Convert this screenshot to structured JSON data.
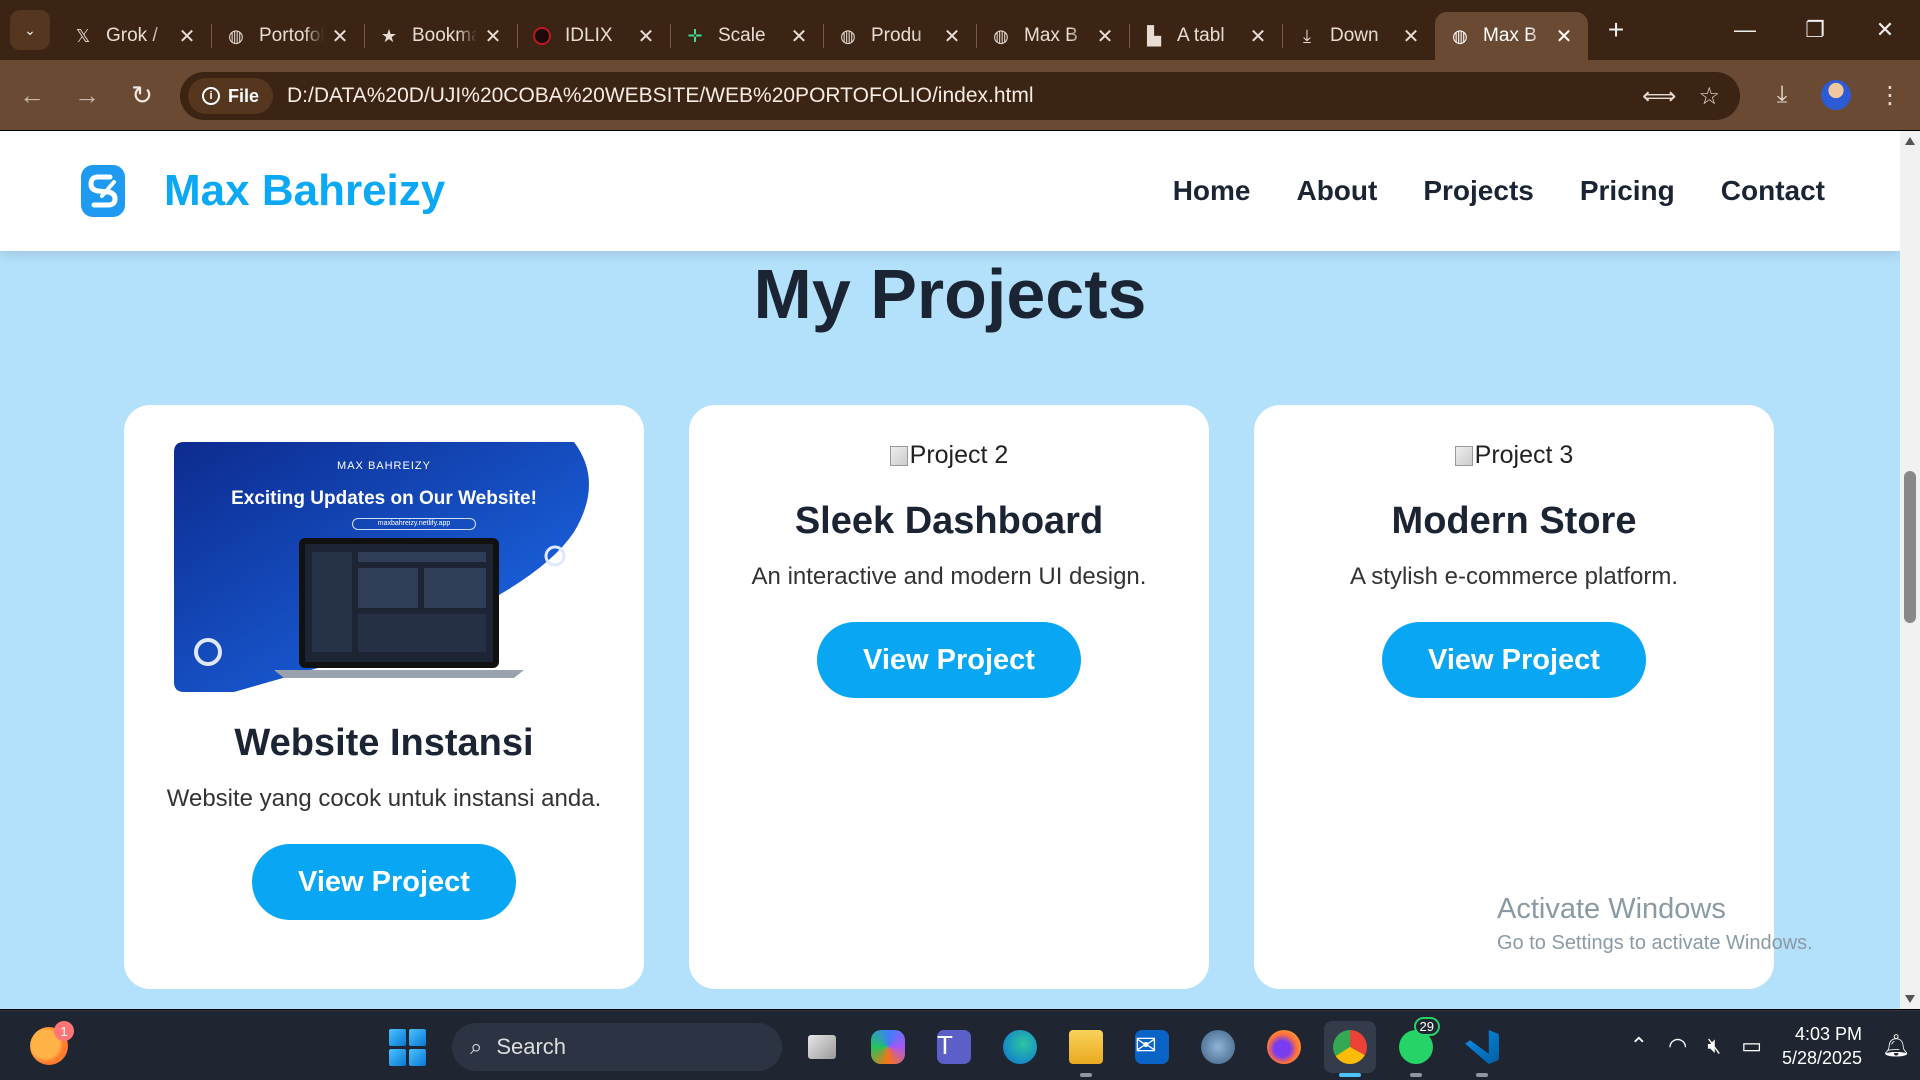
{
  "browser": {
    "tabs": [
      {
        "title": "Grok / ",
        "icon": "x-logo-icon"
      },
      {
        "title": "Portofolio",
        "icon": "globe-icon"
      },
      {
        "title": "Bookmarks",
        "icon": "star-icon"
      },
      {
        "title": "IDLIX",
        "icon": "idlix-icon"
      },
      {
        "title": "Scale",
        "icon": "scale-icon"
      },
      {
        "title": "Produ",
        "icon": "globe-icon"
      },
      {
        "title": "Max B",
        "icon": "globe-icon"
      },
      {
        "title": "A tabl",
        "icon": "table-icon"
      },
      {
        "title": "Down",
        "icon": "download-icon"
      },
      {
        "title": "Max B",
        "icon": "globe-icon",
        "active": true
      }
    ],
    "site_chip": "File",
    "url": "D:/DATA%20D/UJI%20COBA%20WEBSITE/WEB%20PORTOFOLIO/index.html"
  },
  "site": {
    "brand": "Max Bahreizy",
    "nav": [
      "Home",
      "About",
      "Projects",
      "Pricing",
      "Contact"
    ],
    "section_title": "My Projects",
    "projects": [
      {
        "title": "Website Instansi",
        "description": "Website yang cocok untuk instansi anda.",
        "button": "View Project",
        "thumbnail": {
          "brand": "MAX BAHREIZY",
          "headline": "Exciting Updates on Our Website!",
          "url_pill": "maxbahreizy.netlify.app"
        }
      },
      {
        "image_alt": "Project 2",
        "title": "Sleek Dashboard",
        "description": "An interactive and modern UI design.",
        "button": "View Project"
      },
      {
        "image_alt": "Project 3",
        "title": "Modern Store",
        "description": "A stylish e-commerce platform.",
        "button": "View Project"
      }
    ]
  },
  "watermark": {
    "line1": "Activate Windows",
    "line2": "Go to Settings to activate Windows."
  },
  "taskbar": {
    "weather_badge": "1",
    "search_placeholder": "Search",
    "whatsapp_count": "29",
    "time": "4:03 PM",
    "date": "5/28/2025"
  },
  "colors": {
    "accent": "#08a6f3",
    "page_bg": "#b3e0fa",
    "heading": "#1b2433",
    "chrome_frame": "#3b2414",
    "chrome_toolbar": "#6b4a33"
  }
}
